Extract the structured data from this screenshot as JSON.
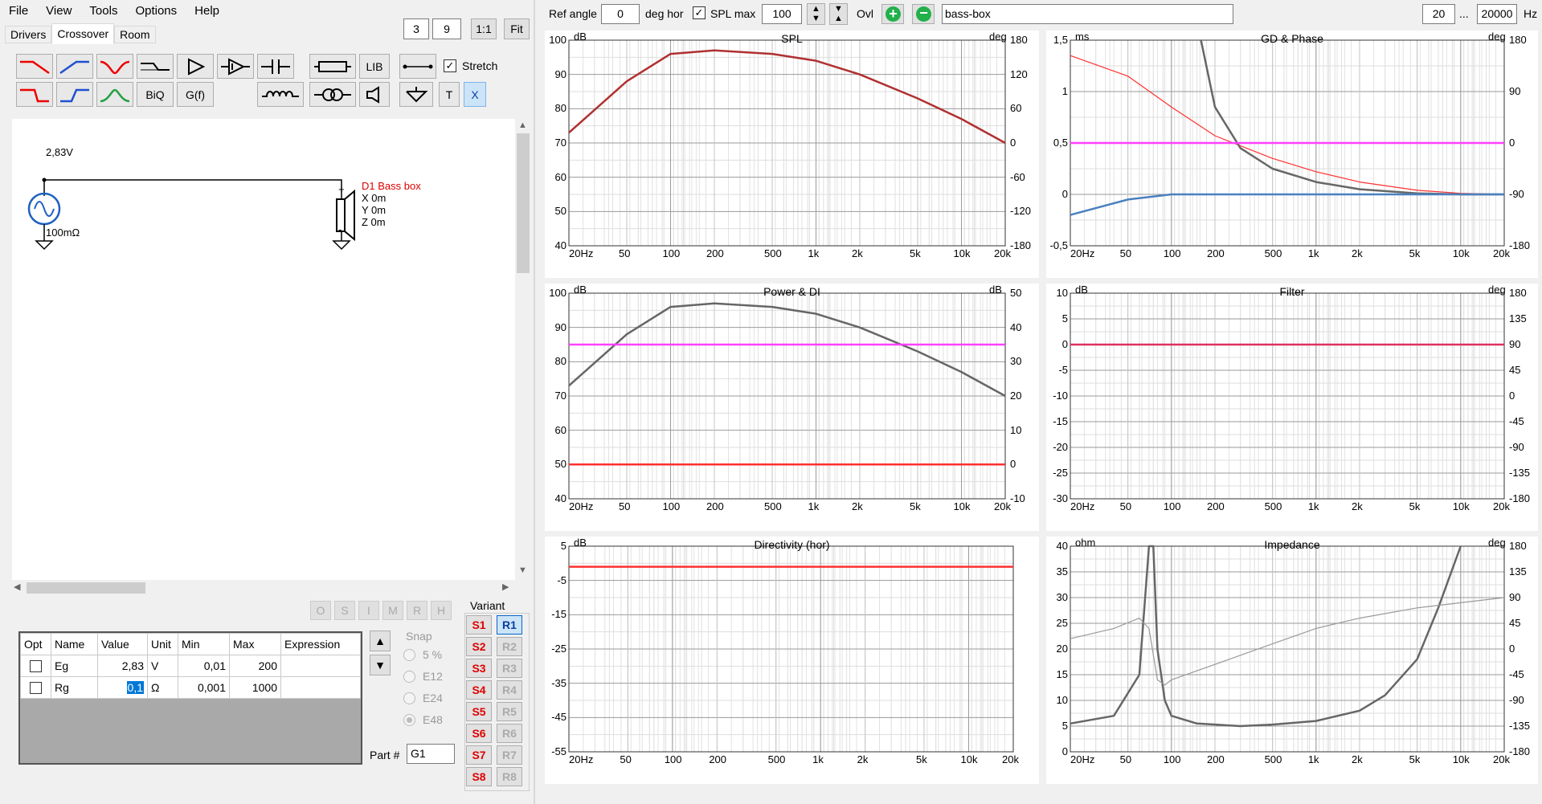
{
  "menu": [
    "File",
    "View",
    "Tools",
    "Options",
    "Help"
  ],
  "topsmall": {
    "a": "3",
    "b": "9",
    "ratio": "1:1",
    "fit": "Fit"
  },
  "tabs": [
    "Drivers",
    "Crossover",
    "Room"
  ],
  "toolbar": {
    "lib": "LIB",
    "stretch": "Stretch",
    "biq": "BiQ",
    "gf": "G(f)",
    "t": "T",
    "x": "X"
  },
  "schematic": {
    "voltage": "2,83V",
    "resistance": "100mΩ",
    "driver_name": "D1 Bass box",
    "driver_x": "X 0m",
    "driver_y": "Y 0m",
    "driver_z": "Z 0m",
    "plus": "+",
    "minus": "-"
  },
  "state_buttons": [
    "O",
    "S",
    "I",
    "M",
    "R",
    "H"
  ],
  "params": {
    "headers": [
      "Opt",
      "Name",
      "Value",
      "Unit",
      "Min",
      "Max",
      "Expression"
    ],
    "rows": [
      {
        "name": "Eg",
        "value": "2,83",
        "unit": "V",
        "min": "0,01",
        "max": "200",
        "expr": ""
      },
      {
        "name": "Rg",
        "value": "0,1",
        "unit": "Ω",
        "min": "0,001",
        "max": "1000",
        "expr": ""
      }
    ]
  },
  "snap": {
    "label": "Snap",
    "opts": [
      "5 %",
      "E12",
      "E24",
      "E48"
    ]
  },
  "part": {
    "label": "Part #",
    "value": "G1"
  },
  "variant": {
    "label": "Variant",
    "s": [
      "S1",
      "S2",
      "S3",
      "S4",
      "S5",
      "S6",
      "S7",
      "S8"
    ],
    "r": [
      "R1",
      "R2",
      "R3",
      "R4",
      "R5",
      "R6",
      "R7",
      "R8"
    ]
  },
  "top": {
    "ref_angle_label": "Ref angle",
    "ref_angle": "0",
    "deg_hor": "deg hor",
    "spl_max_label": "SPL max",
    "spl_max": "100",
    "ovl": "Ovl",
    "name": "bass-box",
    "fmin": "20",
    "dots": "...",
    "fmax": "20000",
    "hz": "Hz"
  },
  "xticks": [
    "20Hz",
    "50",
    "100",
    "200",
    "500",
    "1k",
    "2k",
    "5k",
    "10k",
    "20k"
  ],
  "charts": {
    "spl": {
      "title": "SPL",
      "lunit": "dB",
      "runit": "deg",
      "ly": [
        "100",
        "90",
        "80",
        "70",
        "60",
        "50",
        "40"
      ],
      "ry": [
        "180",
        "120",
        "60",
        "0",
        "-60",
        "-120",
        "-180"
      ]
    },
    "gd": {
      "title": "GD & Phase",
      "lunit": "ms",
      "runit": "deg",
      "ly": [
        "1,5",
        "1",
        "0,5",
        "0",
        "-0,5"
      ],
      "ry": [
        "180",
        "90",
        "0",
        "-90",
        "-180"
      ]
    },
    "power": {
      "title": "Power & DI",
      "lunit": "dB",
      "runit": "dB",
      "ly": [
        "100",
        "90",
        "80",
        "70",
        "60",
        "50",
        "40"
      ],
      "ry": [
        "50",
        "40",
        "30",
        "20",
        "10",
        "0",
        "-10"
      ]
    },
    "filter": {
      "title": "Filter",
      "lunit": "dB",
      "runit": "deg",
      "ly": [
        "10",
        "5",
        "0",
        "-5",
        "-10",
        "-15",
        "-20",
        "-25",
        "-30"
      ],
      "ry": [
        "180",
        "135",
        "90",
        "45",
        "0",
        "-45",
        "-90",
        "-135",
        "-180"
      ]
    },
    "dir": {
      "title": "Directivity (hor)",
      "lunit": "dB",
      "ly": [
        "5",
        "-5",
        "-15",
        "-25",
        "-35",
        "-45",
        "-55"
      ]
    },
    "imp": {
      "title": "Impedance",
      "lunit": "ohm",
      "runit": "deg",
      "ly": [
        "40",
        "35",
        "30",
        "25",
        "20",
        "15",
        "10",
        "5",
        "0"
      ],
      "ry": [
        "180",
        "135",
        "90",
        "45",
        "0",
        "-45",
        "-90",
        "-135",
        "-180"
      ]
    }
  },
  "chart_data": [
    {
      "type": "line",
      "title": "SPL",
      "ylabel": "dB",
      "y2label": "deg",
      "xscale": "log",
      "xlim": [
        20,
        20000
      ],
      "ylim": [
        40,
        100
      ],
      "y2lim": [
        -180,
        180
      ],
      "series": [
        {
          "color": "#b03030",
          "x": [
            20,
            50,
            100,
            200,
            500,
            1000,
            2000,
            5000,
            10000,
            20000
          ],
          "y": [
            73,
            88,
            96,
            97,
            96,
            94,
            90,
            83,
            77,
            70
          ]
        }
      ]
    },
    {
      "type": "line",
      "title": "GD & Phase",
      "ylabel": "ms",
      "y2label": "deg",
      "xscale": "log",
      "xlim": [
        20,
        20000
      ],
      "ylim": [
        -0.5,
        1.5
      ],
      "y2lim": [
        -180,
        180
      ],
      "series": [
        {
          "color": "#ff3030",
          "x": [
            20,
            50,
            100,
            200,
            500,
            1000,
            2000,
            5000,
            10000,
            20000
          ],
          "y": [
            1.35,
            1.15,
            0.85,
            0.57,
            0.35,
            0.22,
            0.12,
            0.04,
            0.01,
            0
          ]
        },
        {
          "color": "#666666",
          "x": [
            160,
            200,
            300,
            500,
            1000,
            2000,
            5000,
            10000,
            20000
          ],
          "y": [
            1.5,
            0.85,
            0.45,
            0.25,
            0.12,
            0.05,
            0.01,
            0,
            0
          ]
        },
        {
          "color": "#ff40ff",
          "x": [
            20,
            20000
          ],
          "y": [
            0.5,
            0.5
          ]
        },
        {
          "color": "#4a80c0",
          "x": [
            20,
            50,
            100,
            200,
            500,
            1000,
            20000
          ],
          "y": [
            -0.2,
            -0.05,
            0,
            0,
            0,
            0,
            0
          ]
        }
      ]
    },
    {
      "type": "line",
      "title": "Power & DI",
      "ylabel": "dB",
      "y2label": "dB",
      "xscale": "log",
      "xlim": [
        20,
        20000
      ],
      "ylim": [
        40,
        100
      ],
      "y2lim": [
        -10,
        50
      ],
      "series": [
        {
          "color": "#666666",
          "x": [
            20,
            50,
            100,
            200,
            500,
            1000,
            2000,
            5000,
            10000,
            20000
          ],
          "y": [
            73,
            88,
            96,
            97,
            96,
            94,
            90,
            83,
            77,
            70
          ]
        },
        {
          "color": "#ff40ff",
          "x": [
            20,
            20000
          ],
          "y": [
            85,
            85
          ]
        },
        {
          "color": "#ff3030",
          "x": [
            20,
            20000
          ],
          "y": [
            50,
            50
          ]
        }
      ]
    },
    {
      "type": "line",
      "title": "Filter",
      "ylabel": "dB",
      "y2label": "deg",
      "xscale": "log",
      "xlim": [
        20,
        20000
      ],
      "ylim": [
        -30,
        10
      ],
      "y2lim": [
        -180,
        180
      ],
      "series": [
        {
          "color": "#e03060",
          "x": [
            20,
            20000
          ],
          "y": [
            0,
            0
          ]
        }
      ]
    },
    {
      "type": "line",
      "title": "Directivity (hor)",
      "ylabel": "dB",
      "xscale": "log",
      "xlim": [
        20,
        20000
      ],
      "ylim": [
        -55,
        5
      ],
      "series": [
        {
          "color": "#ff3030",
          "x": [
            20,
            20000
          ],
          "y": [
            -1,
            -1
          ]
        }
      ]
    },
    {
      "type": "line",
      "title": "Impedance",
      "ylabel": "ohm",
      "y2label": "deg",
      "xscale": "log",
      "xlim": [
        20,
        20000
      ],
      "ylim": [
        0,
        40
      ],
      "y2lim": [
        -180,
        180
      ],
      "series": [
        {
          "color": "#666666",
          "x": [
            20,
            40,
            60,
            70,
            75,
            80,
            90,
            100,
            150,
            300,
            500,
            1000,
            2000,
            3000,
            5000,
            7000,
            10000
          ],
          "y": [
            5.5,
            7,
            15,
            40,
            40,
            20,
            10,
            7,
            5.5,
            5,
            5.3,
            6,
            8,
            11,
            18,
            28,
            40
          ]
        },
        {
          "color": "#999999",
          "x": [
            20,
            40,
            60,
            70,
            80,
            90,
            100,
            200,
            500,
            1000,
            2000,
            5000,
            10000,
            20000
          ],
          "y": [
            22,
            24,
            26,
            24,
            14,
            13,
            14,
            17,
            21,
            24,
            26,
            28,
            29,
            30
          ]
        }
      ]
    }
  ]
}
